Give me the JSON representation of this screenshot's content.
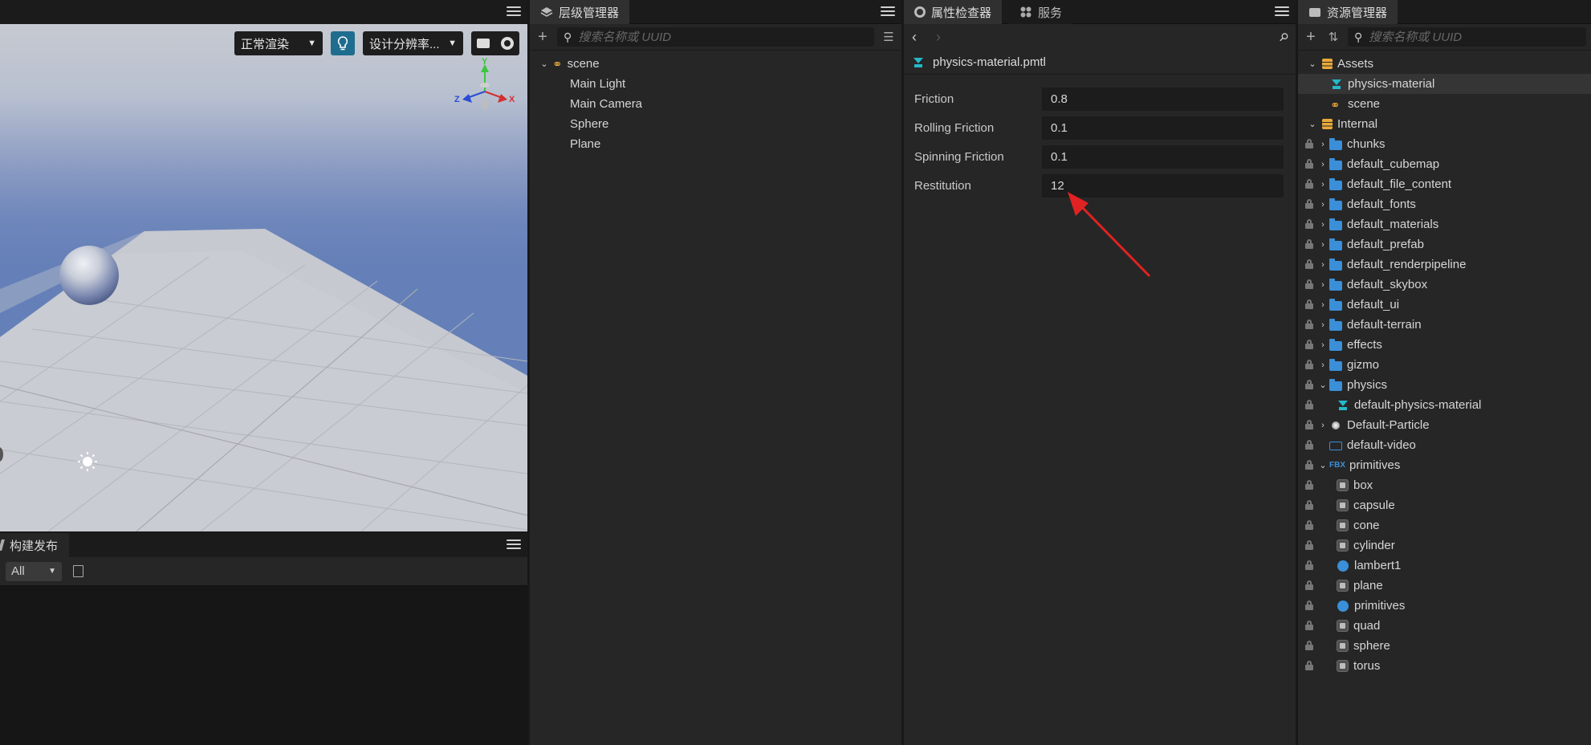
{
  "scene_view": {
    "render_mode": "正常渲染",
    "resolution": "设计分辨率...",
    "gizmo_axes": {
      "x": "X",
      "y": "Y",
      "z": "Z"
    }
  },
  "build_panel": {
    "title": "构建发布",
    "filter_value": "All"
  },
  "hierarchy": {
    "title": "层级管理器",
    "search_placeholder": "搜索名称或 UUID",
    "root": "scene",
    "children": [
      "Main Light",
      "Main Camera",
      "Sphere",
      "Plane"
    ]
  },
  "inspector": {
    "tab_inspector": "属性检查器",
    "tab_service": "服务",
    "file_name": "physics-material.pmtl",
    "fields": [
      {
        "label": "Friction",
        "value": "0.8"
      },
      {
        "label": "Rolling Friction",
        "value": "0.1"
      },
      {
        "label": "Spinning Friction",
        "value": "0.1"
      },
      {
        "label": "Restitution",
        "value": "12"
      }
    ]
  },
  "assets": {
    "title": "资源管理器",
    "search_placeholder": "搜索名称或 UUID",
    "assets_root": "Assets",
    "assets_items": [
      "physics-material",
      "scene"
    ],
    "internal_root": "Internal",
    "internal_folders": [
      "chunks",
      "default_cubemap",
      "default_file_content",
      "default_fonts",
      "default_materials",
      "default_prefab",
      "default_renderpipeline",
      "default_skybox",
      "default_ui",
      "default-terrain",
      "effects",
      "gizmo",
      "physics"
    ],
    "physics_children": [
      "default-physics-material"
    ],
    "particle": "Default-Particle",
    "video": "default-video",
    "fbx_badge": "FBX",
    "primitives": "primitives",
    "primitive_items": [
      "box",
      "capsule",
      "cone",
      "cylinder",
      "lambert1",
      "plane",
      "primitives",
      "quad",
      "sphere",
      "torus"
    ]
  }
}
